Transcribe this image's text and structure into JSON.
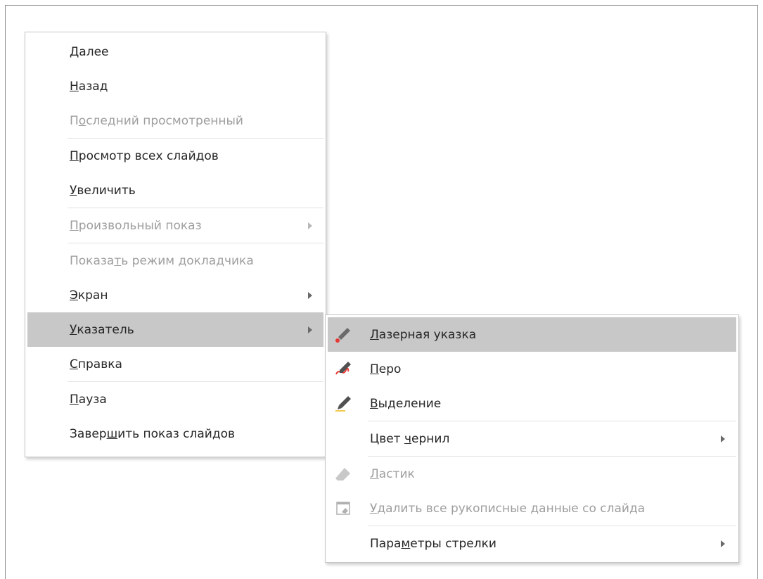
{
  "main_menu": {
    "items": [
      {
        "label": "Далее",
        "underline": "Д"
      },
      {
        "label": "Назад",
        "underline": "Н"
      },
      {
        "label": "Последний просмотренный",
        "underline": "о"
      },
      {
        "label": "Просмотр всех слайдов",
        "underline": "П"
      },
      {
        "label": "Увеличить",
        "underline": "У"
      },
      {
        "label": "Произвольный показ",
        "underline": "П"
      },
      {
        "label": "Показать режим докладчика",
        "underline": "т"
      },
      {
        "label": "Экран",
        "underline": "Э"
      },
      {
        "label": "Указатель",
        "underline": "У"
      },
      {
        "label": "Справка",
        "underline": "С"
      },
      {
        "label": "Пауза",
        "underline": "П"
      },
      {
        "label": "Завершить показ слайдов",
        "underline": "ш"
      }
    ]
  },
  "pointer_submenu": {
    "items": [
      {
        "label": "Лазерная указка",
        "underline": "Л",
        "icon": "laser-pointer-icon"
      },
      {
        "label": "Перо",
        "underline": "П",
        "icon": "pen-icon"
      },
      {
        "label": "Выделение",
        "underline": "В",
        "icon": "highlighter-icon"
      },
      {
        "label": "Цвет чернил",
        "underline": "ч"
      },
      {
        "label": "Ластик",
        "underline": "Л",
        "icon": "eraser-icon"
      },
      {
        "label": "Удалить все рукописные данные со слайда",
        "underline": "У",
        "icon": "erase-all-ink-icon"
      },
      {
        "label": "Параметры стрелки",
        "underline": "м"
      }
    ]
  },
  "colors": {
    "highlight": "#c8c8c8",
    "text": "#262626",
    "disabled_text": "#9e9e9e",
    "laser_red": "#e53935",
    "highlighter_yellow": "#f2c94c"
  }
}
